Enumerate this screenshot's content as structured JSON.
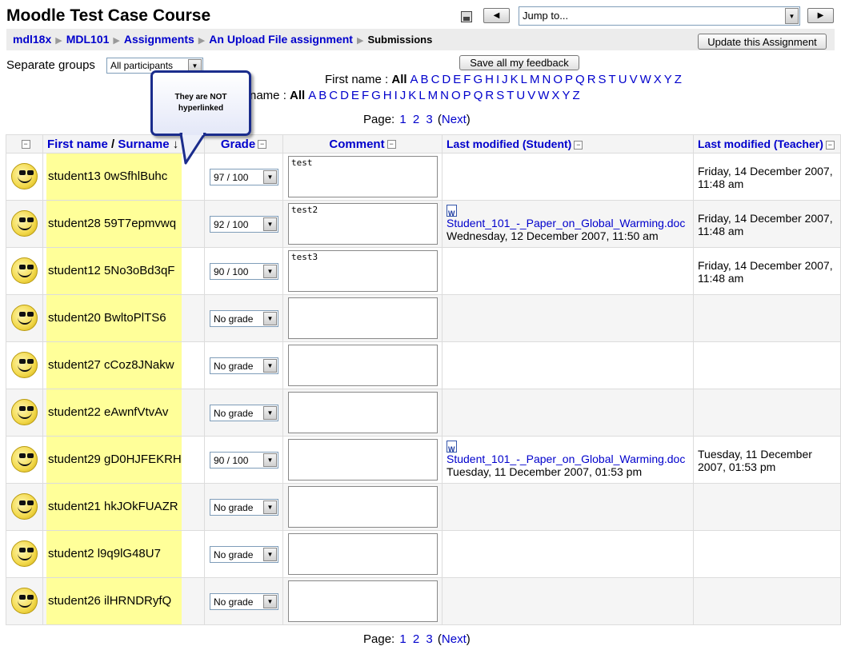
{
  "header": {
    "course_title": "Moodle Test Case Course",
    "prev_glyph": "◀",
    "next_glyph": "▶",
    "jump_placeholder": "Jump to..."
  },
  "breadcrumb": {
    "items": [
      "mdl18x",
      "MDL101",
      "Assignments",
      "An Upload File assignment"
    ],
    "current": "Submissions",
    "separator": "▶"
  },
  "buttons": {
    "update": "Update this Assignment",
    "save_feedback": "Save all my feedback"
  },
  "groups": {
    "label": "Separate groups",
    "selected": "All participants"
  },
  "filters": {
    "first_name_label": "First name :",
    "surname_label": "name :",
    "all": "All",
    "letters": [
      "A",
      "B",
      "C",
      "D",
      "E",
      "F",
      "G",
      "H",
      "I",
      "J",
      "K",
      "L",
      "M",
      "N",
      "O",
      "P",
      "Q",
      "R",
      "S",
      "T",
      "U",
      "V",
      "W",
      "X",
      "Y",
      "Z"
    ]
  },
  "pager": {
    "label": "Page:",
    "pages": [
      "1",
      "2",
      "3"
    ],
    "next": "Next",
    "open_paren": "(",
    "close_paren": ")"
  },
  "callout": {
    "line1": "They are NOT",
    "line2": "hyperlinked"
  },
  "table": {
    "col_first": "First name",
    "col_slash": " / ",
    "col_surname": "Surname",
    "sort_arrow": "↓",
    "col_grade": "Grade",
    "col_comment": "Comment",
    "col_student_modified": "Last modified (Student)",
    "col_teacher_modified": "Last modified (Teacher)",
    "collapse_glyph": "−",
    "rows": [
      {
        "name": "student13 0wSfhlBuhc",
        "grade": "97 / 100",
        "comment": "test",
        "file": "",
        "student_date": "",
        "teacher_date": "Friday, 14 December 2007, 11:48 am"
      },
      {
        "name": "student28 59T7epmvwq",
        "grade": "92 / 100",
        "comment": "test2",
        "file": "Student_101_-_Paper_on_Global_Warming.doc",
        "student_date": "Wednesday, 12 December 2007, 11:50 am",
        "teacher_date": "Friday, 14 December 2007, 11:48 am"
      },
      {
        "name": "student12 5No3oBd3qF",
        "grade": "90 / 100",
        "comment": "test3",
        "file": "",
        "student_date": "",
        "teacher_date": "Friday, 14 December 2007, 11:48 am"
      },
      {
        "name": "student20 BwltoPlTS6",
        "grade": "No grade",
        "comment": "",
        "file": "",
        "student_date": "",
        "teacher_date": ""
      },
      {
        "name": "student27 cCoz8JNakw",
        "grade": "No grade",
        "comment": "",
        "file": "",
        "student_date": "",
        "teacher_date": ""
      },
      {
        "name": "student22 eAwnfVtvAv",
        "grade": "No grade",
        "comment": "",
        "file": "",
        "student_date": "",
        "teacher_date": ""
      },
      {
        "name": "student29 gD0HJFEKRH",
        "grade": "90 / 100",
        "comment": "",
        "file": "Student_101_-_Paper_on_Global_Warming.doc",
        "student_date": "Tuesday, 11 December 2007, 01:53 pm",
        "teacher_date": "Tuesday, 11 December 2007, 01:53 pm"
      },
      {
        "name": "student21 hkJOkFUAZR",
        "grade": "No grade",
        "comment": "",
        "file": "",
        "student_date": "",
        "teacher_date": ""
      },
      {
        "name": "student2 l9q9lG48U7",
        "grade": "No grade",
        "comment": "",
        "file": "",
        "student_date": "",
        "teacher_date": ""
      },
      {
        "name": "student26 ilHRNDRyfQ",
        "grade": "No grade",
        "comment": "",
        "file": "",
        "student_date": "",
        "teacher_date": ""
      }
    ]
  },
  "colors": {
    "link": "#0000cc",
    "highlight": "#ffff99",
    "callout_border": "#1a2c8c"
  }
}
